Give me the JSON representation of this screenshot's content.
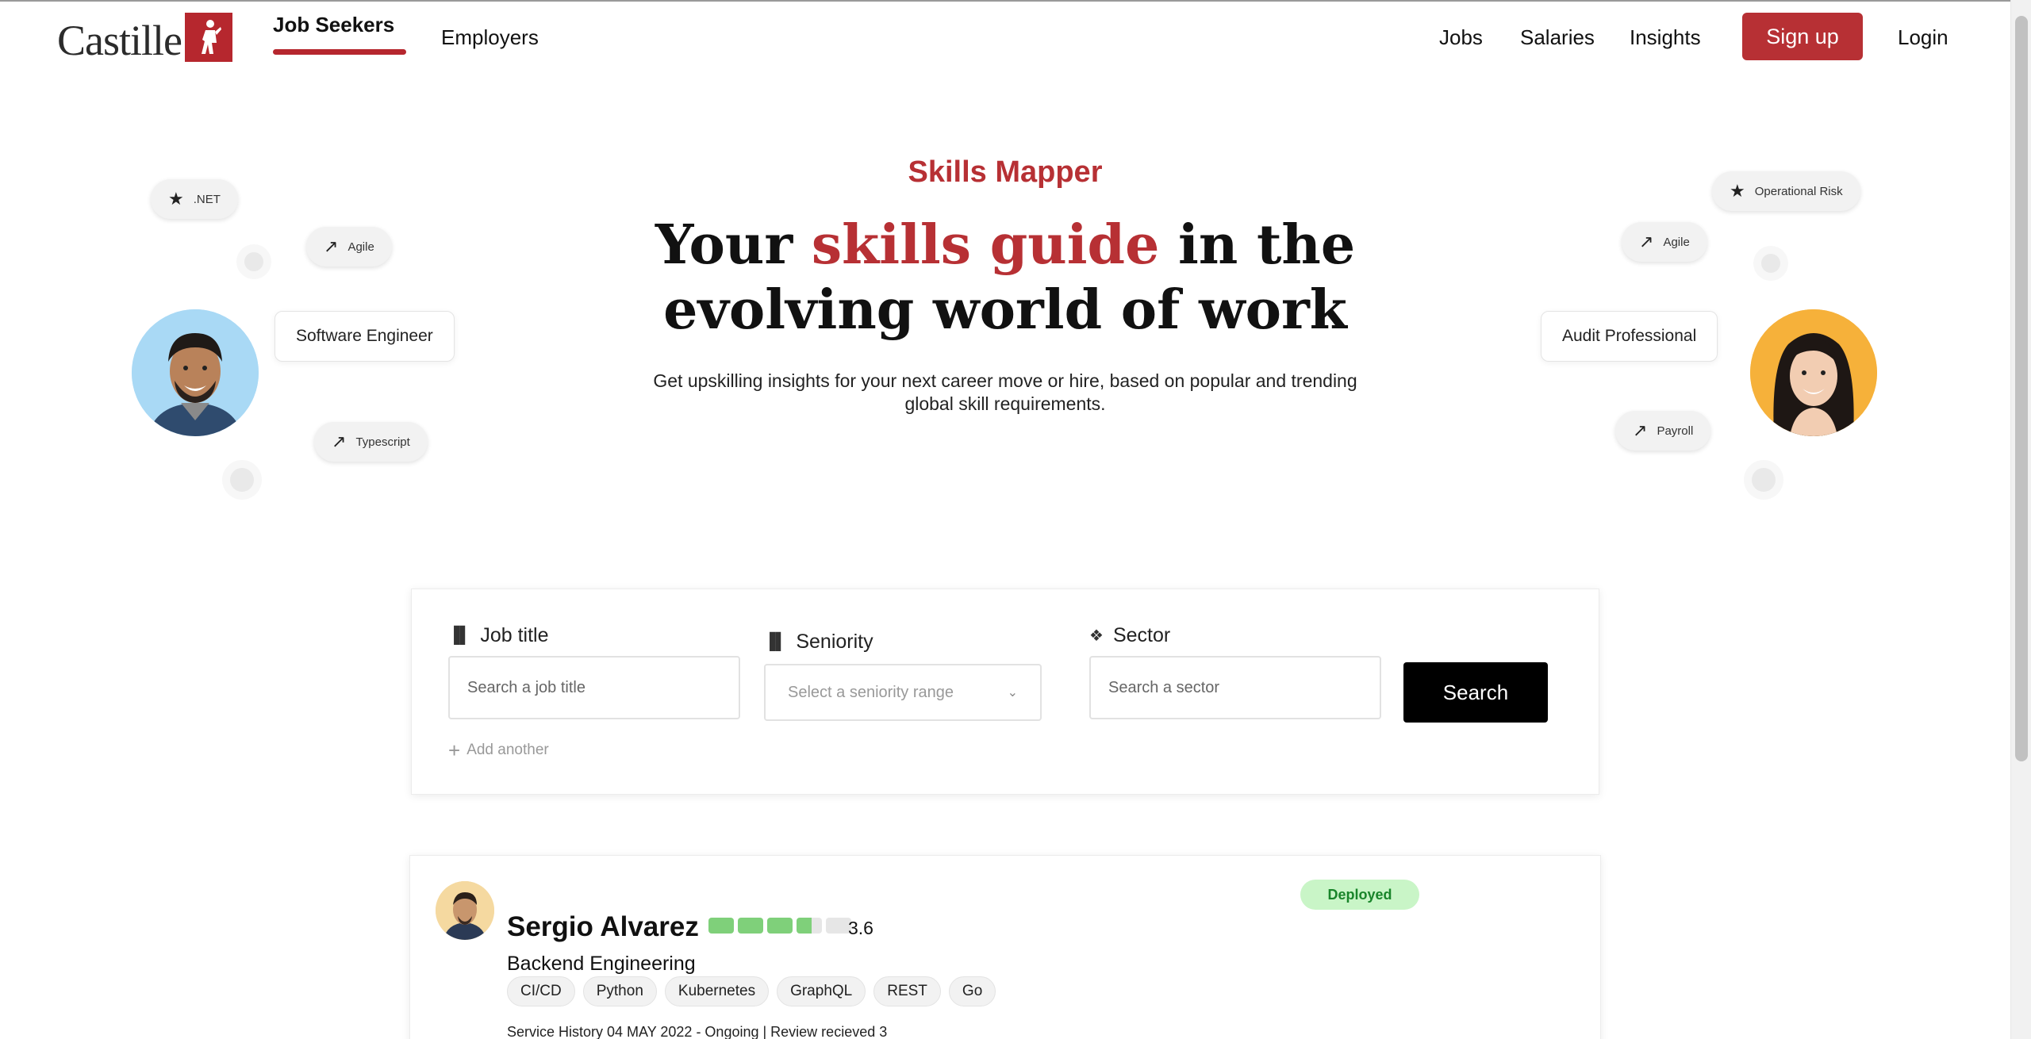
{
  "brand": {
    "name": "Castille"
  },
  "nav": {
    "job_seekers": "Job Seekers",
    "employers": "Employers",
    "jobs": "Jobs",
    "salaries": "Salaries",
    "insights": "Insights",
    "signup": "Sign up",
    "login": "Login"
  },
  "hero": {
    "kicker": "Skills Mapper",
    "title_pre": "Your ",
    "title_accent": "skills guide",
    "title_post": " in the",
    "title_line2": "evolving world of work",
    "subtitle": "Get upskilling insights for your next career move or hire, based on popular and trending global skill requirements."
  },
  "left_float": {
    "chips": [
      {
        "icon": "star-icon",
        "label": ".NET"
      },
      {
        "icon": "trending-up-icon",
        "label": "Agile"
      },
      {
        "icon": "trending-up-icon",
        "label": "Typescript"
      }
    ],
    "role": "Software Engineer"
  },
  "right_float": {
    "chips": [
      {
        "icon": "star-icon",
        "label": "Operational Risk"
      },
      {
        "icon": "trending-up-icon",
        "label": "Agile"
      },
      {
        "icon": "trending-up-icon",
        "label": "Payroll"
      }
    ],
    "role": "Audit Professional"
  },
  "search": {
    "job_title_label": "Job title",
    "job_title_placeholder": "Search a job title",
    "seniority_label": "Seniority",
    "seniority_placeholder": "Select a seniority range",
    "sector_label": "Sector",
    "sector_placeholder": "Search a sector",
    "search_button": "Search",
    "add_another": "Add another"
  },
  "profile": {
    "name": "Sergio Alvarez",
    "rating": "3.6",
    "rating_fraction": 0.72,
    "status": "Deployed",
    "role": "Backend Engineering",
    "tags": [
      "CI/CD",
      "Python",
      "Kubernetes",
      "GraphQL",
      "REST",
      "Go"
    ],
    "history": "Service History 04 MAY 2022 - Ongoing |   Review recieved   3"
  },
  "colors": {
    "brand_red": "#b73034",
    "status_green": "#19852a",
    "status_green_bg": "#c9f5c7",
    "rating_green": "#7fd07a"
  }
}
